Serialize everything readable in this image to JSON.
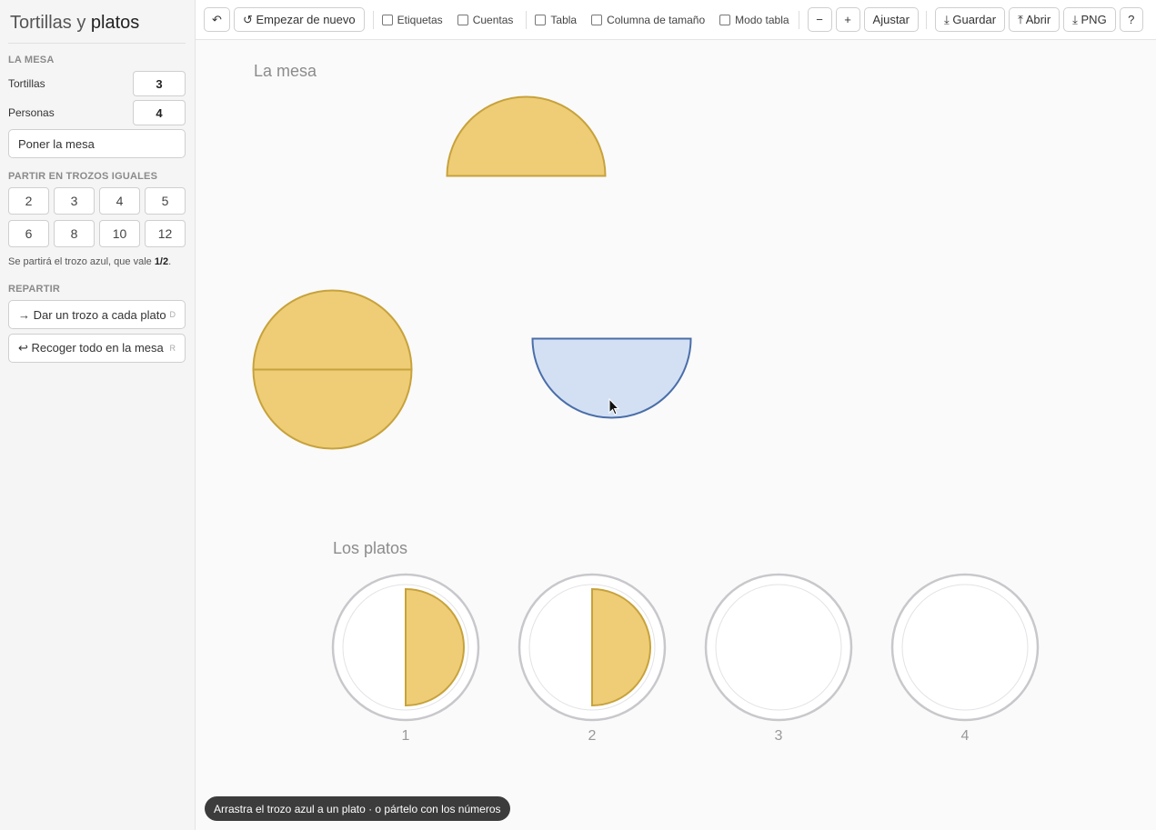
{
  "app": {
    "title_part1": "Tortillas",
    "title_sep": " y ",
    "title_part2": "platos"
  },
  "sidebar": {
    "table_section": "LA MESA",
    "tortillas_label": "Tortillas",
    "tortillas_value": "3",
    "people_label": "Personas",
    "people_value": "4",
    "set_table_button": "Poner la mesa",
    "split_section": "PARTIR EN TROZOS IGUALES",
    "split_options": [
      "2",
      "3",
      "4",
      "5",
      "6",
      "8",
      "10",
      "12"
    ],
    "split_note_prefix": "Se partirá el trozo azul, que vale ",
    "split_note_value": "1/2",
    "split_note_suffix": ".",
    "distribute_section": "REPARTIR",
    "give_button": "→ Dar un trozo a cada plato",
    "give_key": "D",
    "collect_button": "↩ Recoger todo en la mesa",
    "collect_key": "R"
  },
  "toolbar": {
    "undo": "↶",
    "restart": "↺ Empezar de nuevo",
    "checks": [
      {
        "label": "Etiquetas",
        "checked": false
      },
      {
        "label": "Cuentas",
        "checked": false
      },
      {
        "label": "Tabla",
        "checked": false
      },
      {
        "label": "Columna de tamaño",
        "checked": false
      },
      {
        "label": "Modo tabla",
        "checked": false
      }
    ],
    "zoom_out": "−",
    "zoom_in": "+",
    "fit": "Ajustar",
    "save": "⤓ Guardar",
    "open": "⤒ Abrir",
    "png": "⤓ PNG",
    "help": "?"
  },
  "canvas": {
    "table_label": "La mesa",
    "plates_label": "Los platos",
    "plate_numbers": [
      "1",
      "2",
      "3",
      "4"
    ],
    "plate_contents": [
      "1/2",
      "1/2",
      "",
      ""
    ],
    "colors": {
      "tortilla": "#eecd76",
      "tortilla_stroke": "#c7a23c",
      "selected": "#d3e0f4",
      "selected_stroke": "#4a6ea8",
      "plate_stroke": "#c8c8cc"
    }
  },
  "hint": "Arrastra el trozo azul a un plato · o pártelo con los números"
}
